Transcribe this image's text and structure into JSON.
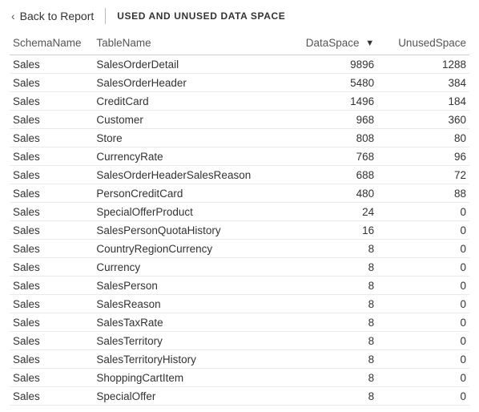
{
  "header": {
    "back_label": "Back to Report",
    "title": "USED AND UNUSED DATA SPACE"
  },
  "columns": {
    "schema": "SchemaName",
    "table": "TableName",
    "dataspace": "DataSpace",
    "unused": "UnusedSpace"
  },
  "sort": {
    "column": "DataSpace",
    "direction": "desc",
    "glyph": "▼"
  },
  "rows": [
    {
      "schema": "Sales",
      "table": "SalesOrderDetail",
      "dataspace": 9896,
      "unused": 1288
    },
    {
      "schema": "Sales",
      "table": "SalesOrderHeader",
      "dataspace": 5480,
      "unused": 384
    },
    {
      "schema": "Sales",
      "table": "CreditCard",
      "dataspace": 1496,
      "unused": 184
    },
    {
      "schema": "Sales",
      "table": "Customer",
      "dataspace": 968,
      "unused": 360
    },
    {
      "schema": "Sales",
      "table": "Store",
      "dataspace": 808,
      "unused": 80
    },
    {
      "schema": "Sales",
      "table": "CurrencyRate",
      "dataspace": 768,
      "unused": 96
    },
    {
      "schema": "Sales",
      "table": "SalesOrderHeaderSalesReason",
      "dataspace": 688,
      "unused": 72
    },
    {
      "schema": "Sales",
      "table": "PersonCreditCard",
      "dataspace": 480,
      "unused": 88
    },
    {
      "schema": "Sales",
      "table": "SpecialOfferProduct",
      "dataspace": 24,
      "unused": 0
    },
    {
      "schema": "Sales",
      "table": "SalesPersonQuotaHistory",
      "dataspace": 16,
      "unused": 0
    },
    {
      "schema": "Sales",
      "table": "CountryRegionCurrency",
      "dataspace": 8,
      "unused": 0
    },
    {
      "schema": "Sales",
      "table": "Currency",
      "dataspace": 8,
      "unused": 0
    },
    {
      "schema": "Sales",
      "table": "SalesPerson",
      "dataspace": 8,
      "unused": 0
    },
    {
      "schema": "Sales",
      "table": "SalesReason",
      "dataspace": 8,
      "unused": 0
    },
    {
      "schema": "Sales",
      "table": "SalesTaxRate",
      "dataspace": 8,
      "unused": 0
    },
    {
      "schema": "Sales",
      "table": "SalesTerritory",
      "dataspace": 8,
      "unused": 0
    },
    {
      "schema": "Sales",
      "table": "SalesTerritoryHistory",
      "dataspace": 8,
      "unused": 0
    },
    {
      "schema": "Sales",
      "table": "ShoppingCartItem",
      "dataspace": 8,
      "unused": 0
    },
    {
      "schema": "Sales",
      "table": "SpecialOffer",
      "dataspace": 8,
      "unused": 0
    }
  ]
}
